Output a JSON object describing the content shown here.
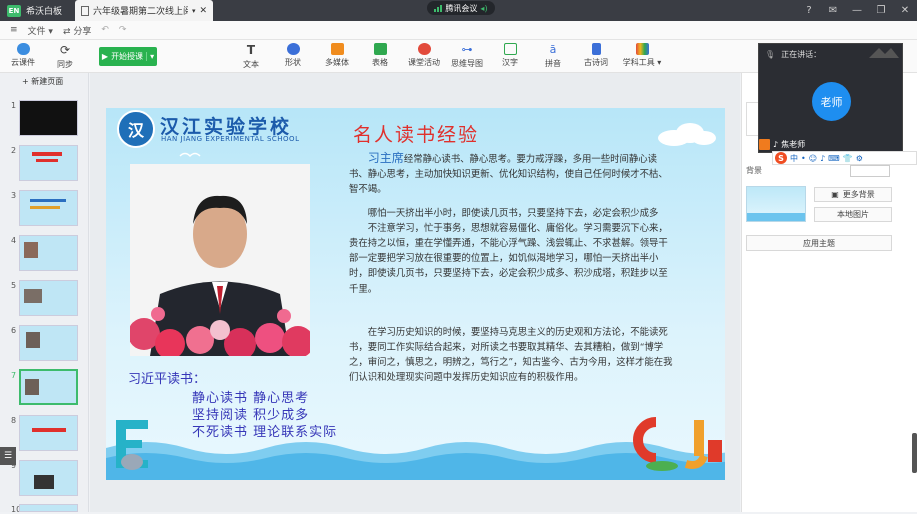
{
  "titlebar": {
    "app_tab": "希沃白板",
    "doc_tab": "六年级暑期第二次线上阅读...",
    "meeting": "腾讯会议"
  },
  "menu": {
    "file": "文件",
    "share": "分享"
  },
  "toolbar": {
    "cloud": "云课件",
    "sync": "同步",
    "start": "开始授课",
    "items": [
      "文本",
      "形状",
      "多媒体",
      "表格",
      "课堂活动",
      "思维导图",
      "汉字",
      "拼音",
      "古诗词",
      "学科工具"
    ]
  },
  "sidebar": {
    "new_page": "新建页面",
    "thumb_numbers": [
      "1",
      "2",
      "3",
      "4",
      "5",
      "6",
      "7",
      "8",
      "9",
      "10"
    ],
    "selected": "7"
  },
  "slide": {
    "logo_char": "汉",
    "school_cn": "汉江实验学校",
    "school_en": "HAN JIANG EXPERIMENTAL SCHOOL",
    "title": "名人读书经验",
    "para1_name": "习主席",
    "para1": "经常静心读书、静心思考。要力戒浮躁，多用一些时间静心读书、静心思考，主动加快知识更新、优化知识结构，使自己任何时候才不枯、智不竭。",
    "para2": "哪怕一天挤出半小时，即使读几页书，只要坚持下去，必定会积少成多",
    "para3": "不注意学习，忙于事务，思想就容易僵化、庸俗化。学习需要沉下心来，贵在持之以恒，重在学懂弄通，不能心浮气躁、浅尝辄止、不求甚解。领导干部一定要把学习放在很重要的位置上，如饥似渴地学习，哪怕一天挤出半小时，即使读几页书，只要坚持下去，必定会积少成多、积沙成塔，积跬步以至千里。",
    "para4": "在学习历史知识的时候，要坚持马克思主义的历史观和方法论，不能读死书，要同工作实际结合起来，对所读之书要取其精华、去其糟粕，做到“博学之，审问之，慎思之，明辨之，笃行之”，知古鉴今、古为今用，这样才能在我们认识和处理现实问题中发挥历史知识应有的积极作用。",
    "quote_title": "习近平读书：",
    "quote_lines": [
      "静心读书  静心思考",
      "坚持阅读  积少成多",
      "不死读书   理论联系实际"
    ]
  },
  "video": {
    "speaking": "正在讲话：",
    "avatar": "老师",
    "name": "焦老师"
  },
  "right_panel": {
    "background_label": "背景",
    "more_bg": "更多背景",
    "local_image": "本地图片",
    "apply_theme": "应用主题"
  }
}
